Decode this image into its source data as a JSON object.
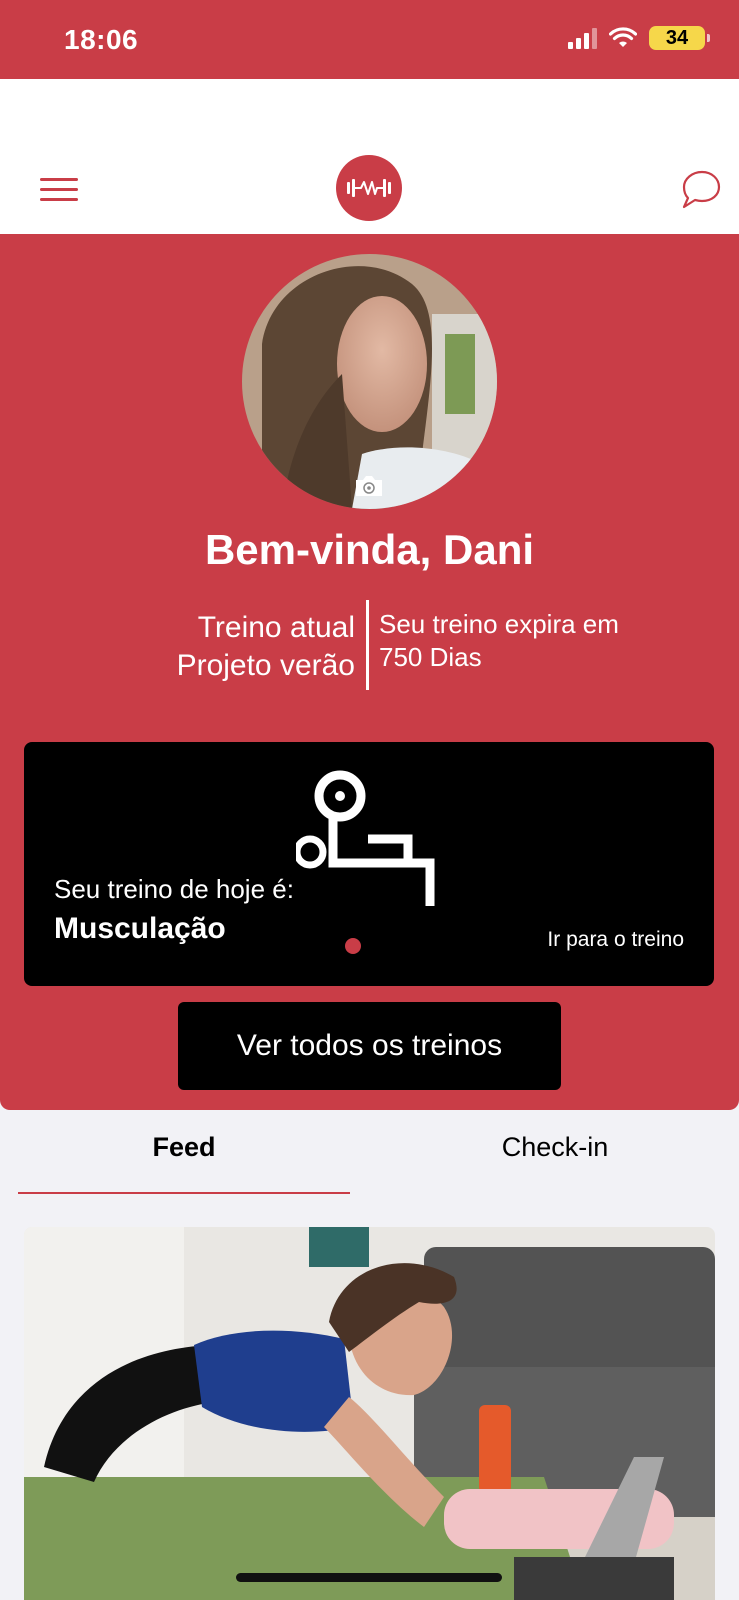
{
  "status_bar": {
    "time": "18:06",
    "battery": "34"
  },
  "header": {
    "menu_icon": "hamburger-menu-icon",
    "logo_icon": "dumbbell-heartbeat-logo",
    "chat_icon": "chat-bubble-icon"
  },
  "profile": {
    "welcome": "Bem-vinda, Dani",
    "current_label": "Treino atual",
    "current_value": "Projeto verão",
    "expire_label": "Seu treino expira em",
    "expire_value": "750 Dias"
  },
  "workout_card": {
    "icon": "bench-press-icon",
    "today_label": "Seu treino de hoje é:",
    "today_workout": "Musculação",
    "go_link": "Ir para o treino"
  },
  "all_workouts_button": "Ver todos os treinos",
  "tabs": [
    {
      "label": "Feed",
      "active": true
    },
    {
      "label": "Check-in",
      "active": false
    }
  ],
  "colors": {
    "brand": "#c93d47",
    "card": "#000000",
    "background": "#f2f2f6"
  }
}
